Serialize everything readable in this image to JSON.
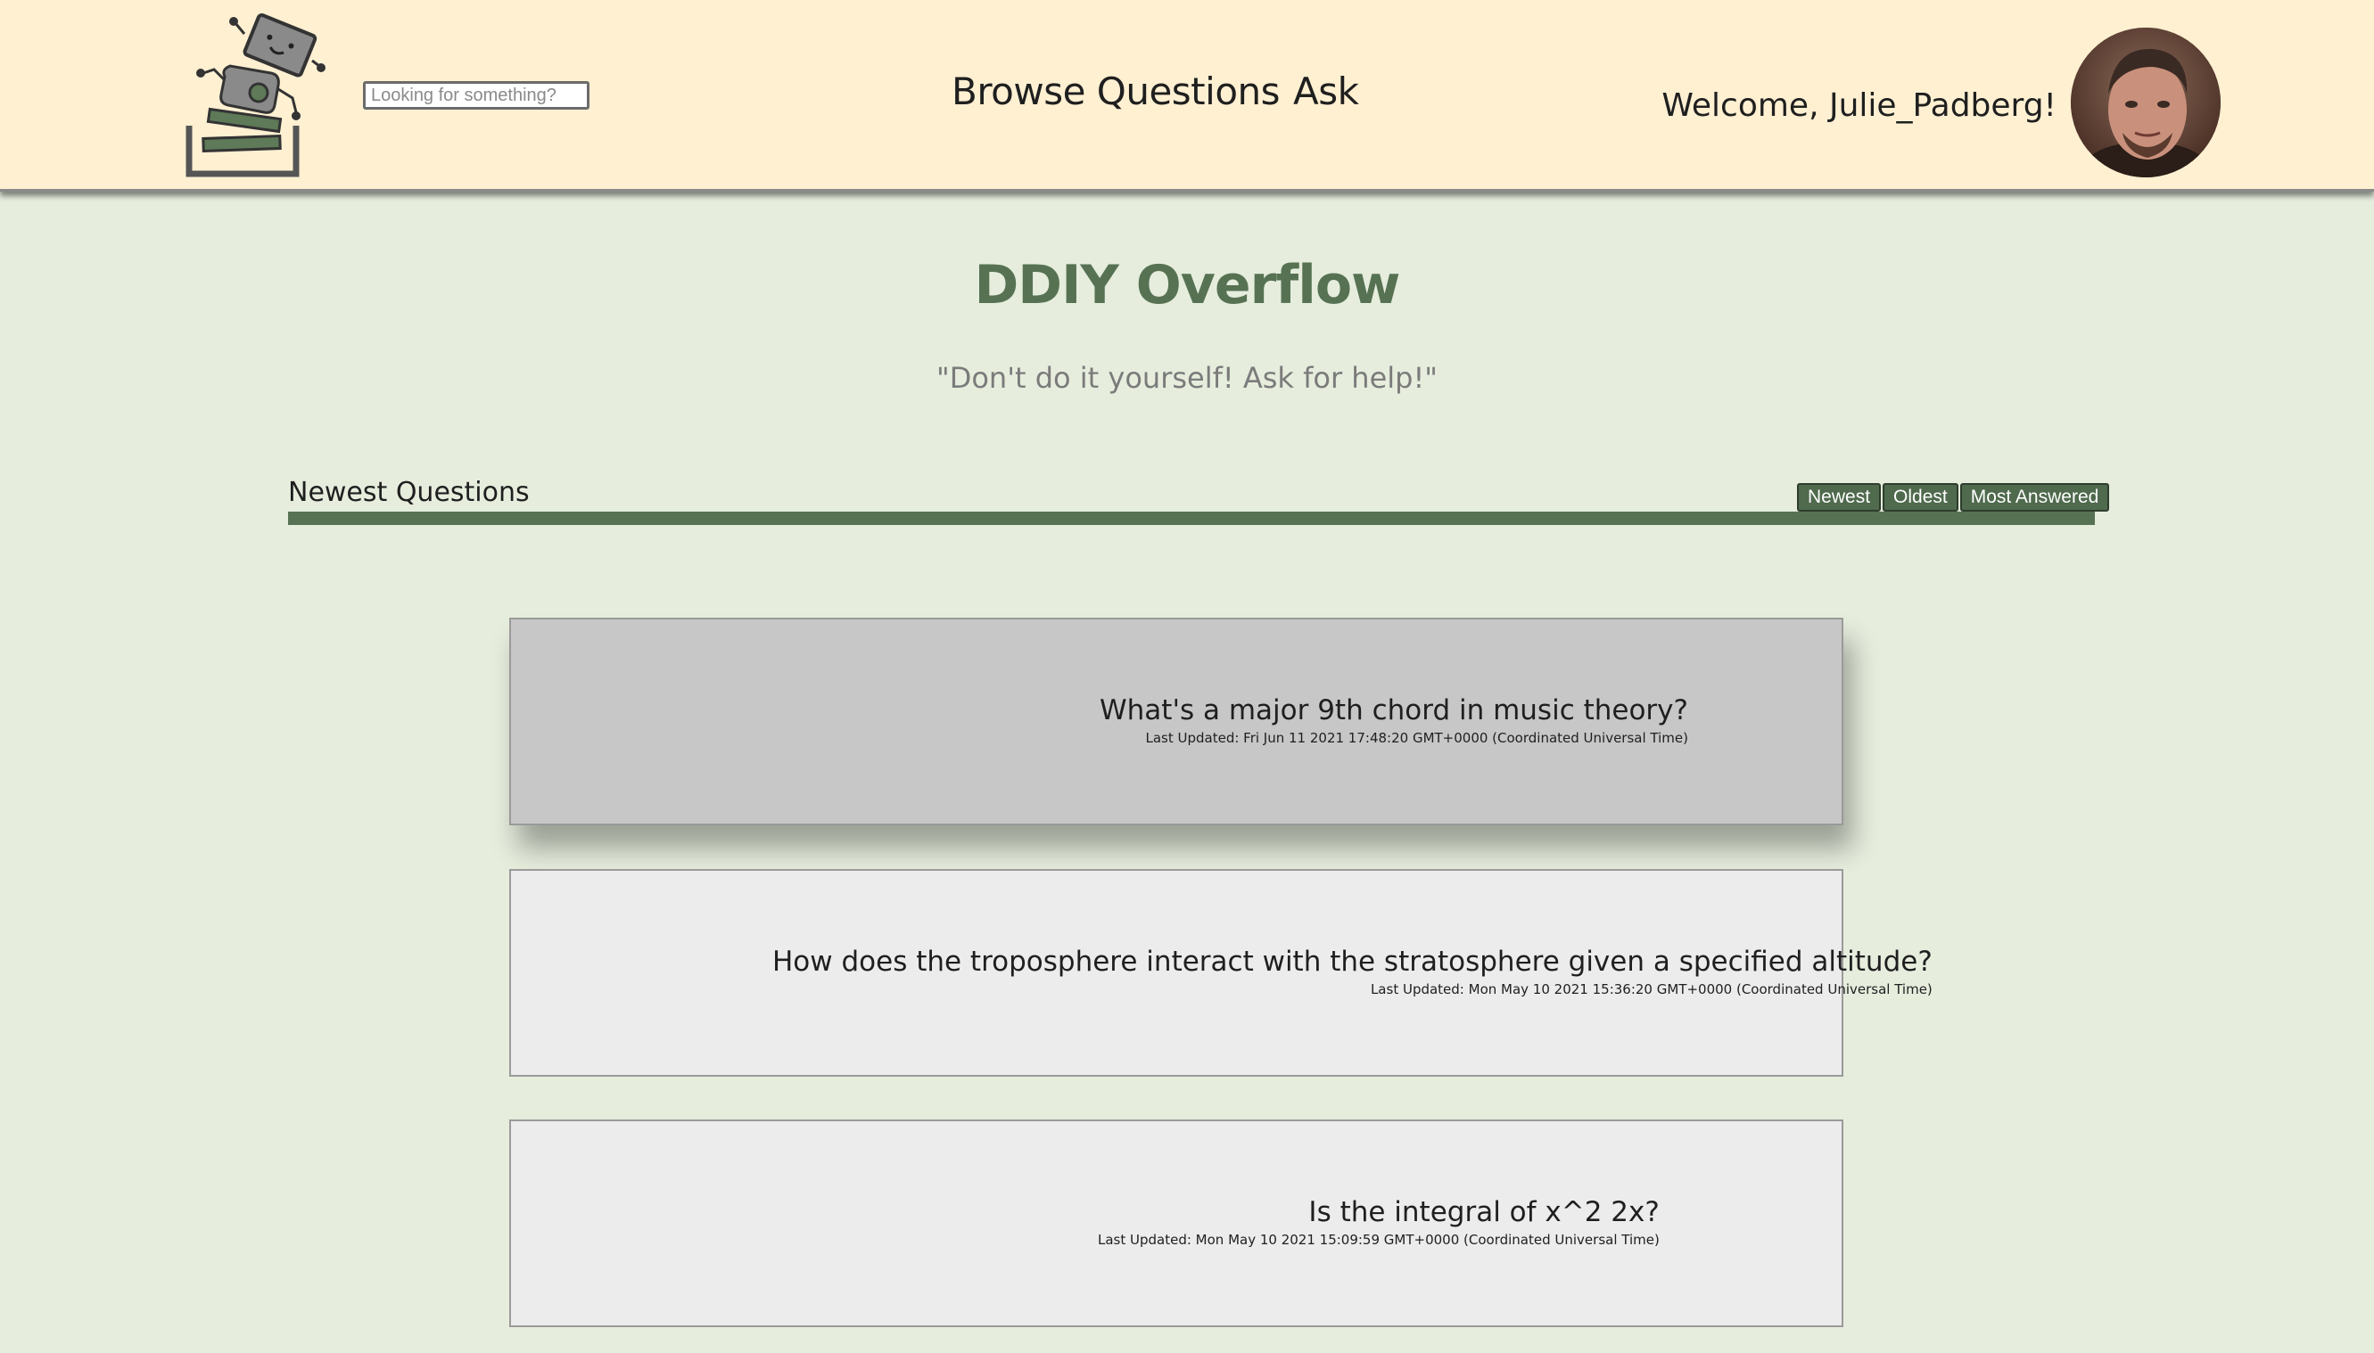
{
  "header": {
    "search_placeholder": "Looking for something?",
    "nav": {
      "browse": "Browse Questions",
      "ask": "Ask"
    },
    "welcome": "Welcome, Julie_Padberg!"
  },
  "hero": {
    "title": "DDIY Overflow",
    "tagline": "\"Don't do it yourself! Ask for help!\""
  },
  "questions_section": {
    "title": "Newest Questions",
    "sort_buttons": [
      "Newest",
      "Oldest",
      "Most Answered"
    ]
  },
  "questions": [
    {
      "title": "What's a major 9th chord in music theory?",
      "updated": "Last Updated: Fri Jun 11 2021 17:48:20 GMT+0000 (Coordinated Universal Time)"
    },
    {
      "title": "How does the troposphere interact with the stratosphere given a specified altitude?",
      "updated": "Last Updated: Mon May 10 2021 15:36:20 GMT+0000 (Coordinated Universal Time)"
    },
    {
      "title": "Is the integral of x^2 2x?",
      "updated": "Last Updated: Mon May 10 2021 15:09:59 GMT+0000 (Coordinated Universal Time)"
    }
  ],
  "colors": {
    "header_bg": "#fff0d2",
    "page_bg": "#e6eddd",
    "accent_green": "#567253",
    "card_bg": "#ececec",
    "card_hover_bg": "#c8c7c8"
  },
  "icons": {
    "logo": "robot-logo-icon",
    "avatar": "user-avatar"
  }
}
